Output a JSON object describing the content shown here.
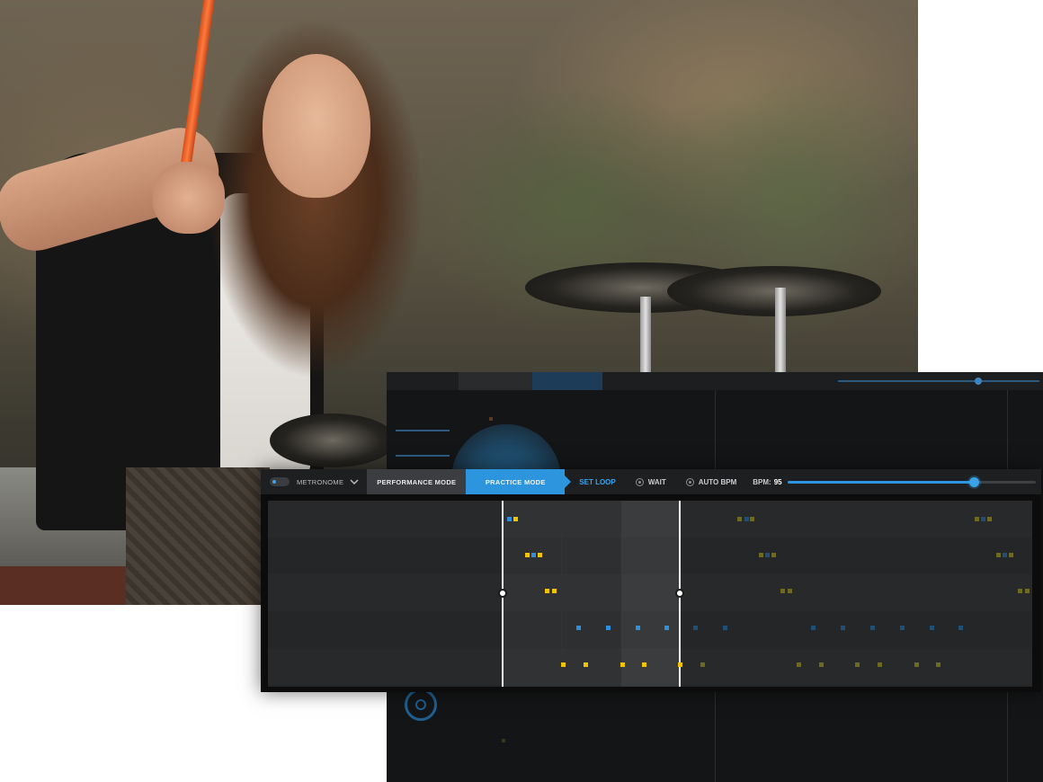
{
  "toolbar": {
    "metronome_label": "METRONOME",
    "performance_mode_label": "PERFORMANCE MODE",
    "practice_mode_label": "PRACTICE MODE",
    "set_loop_label": "SET LOOP",
    "wait_label": "WAIT",
    "auto_bpm_label": "AUTO BPM",
    "bpm_label": "BPM:",
    "bpm_value": "95",
    "bpm_slider_fraction": 0.75
  },
  "colors": {
    "accent_blue": "#2d95dd",
    "note_yellow": "#f2c400",
    "note_blue": "#2f8fdc",
    "panel_bg": "#252627"
  },
  "icons": {
    "metronome_toggle": "toggle-icon",
    "metronome_dropdown": "chevron-down-icon",
    "wait_option": "radio-icon",
    "auto_bpm_option": "radio-icon"
  }
}
